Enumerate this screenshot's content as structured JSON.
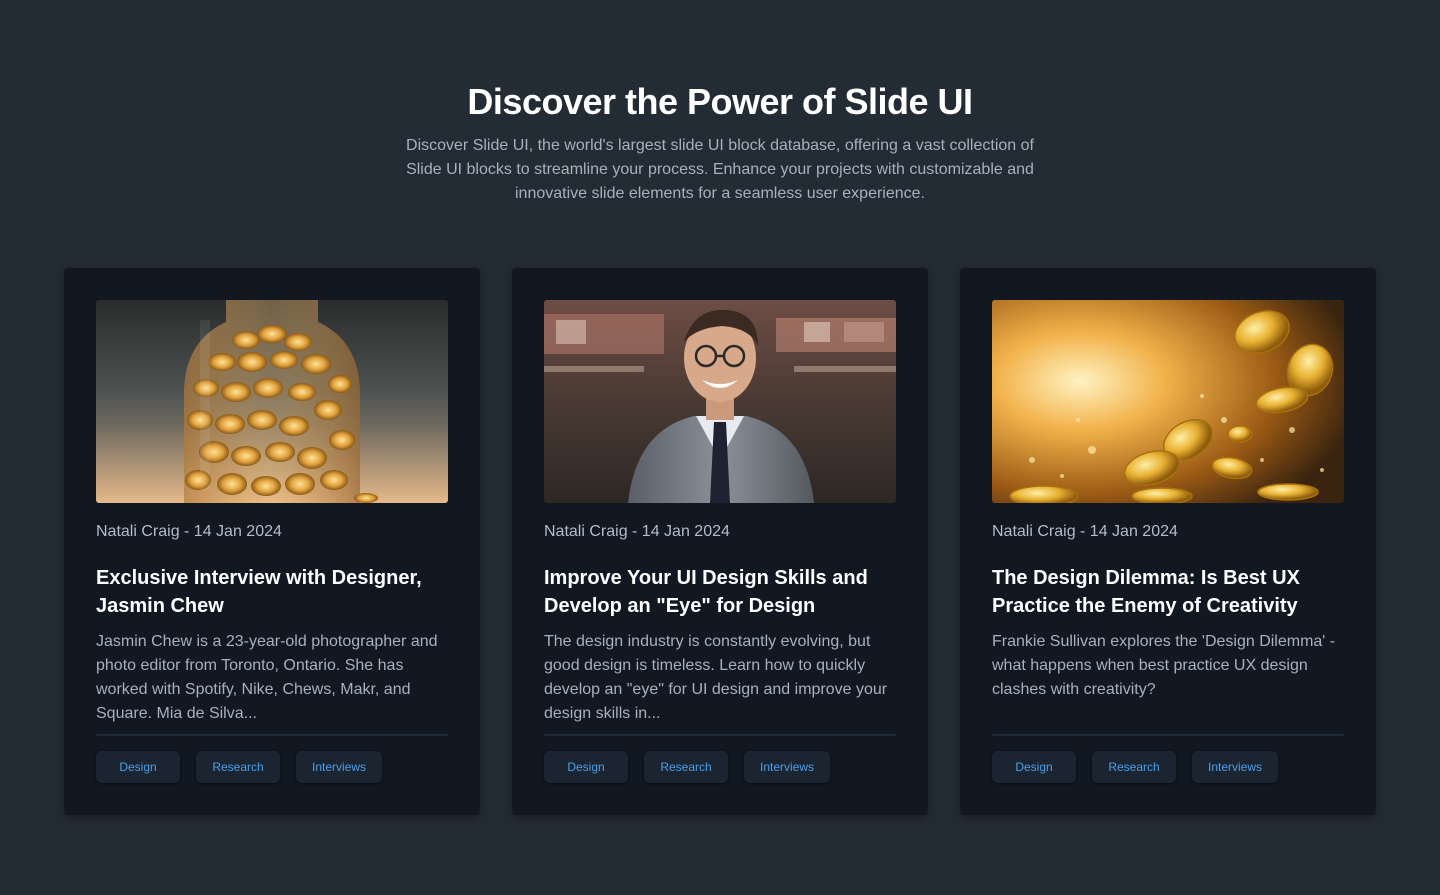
{
  "hero": {
    "title": "Discover the Power of Slide UI",
    "description": "Discover Slide UI, the world's largest slide UI block database, offering a vast collection of Slide UI blocks to streamline your process. Enhance your projects with customizable and innovative slide elements for a seamless user experience."
  },
  "cards": [
    {
      "image": "coin-jar-image",
      "meta": "Natali Craig - 14 Jan 2024",
      "title": "Exclusive Interview with Designer, Jasmin Chew",
      "description": "Jasmin Chew is a 23-year-old photographer and photo editor from Toronto, Ontario. She has worked with Spotify, Nike, Chews, Makr, and Square. Mia de Silva...",
      "tags": [
        "Design",
        "Research",
        "Interviews"
      ]
    },
    {
      "image": "smiling-man-portrait-image",
      "meta": "Natali Craig - 14 Jan 2024",
      "title": "Improve Your UI Design Skills and Develop an \"Eye\" for Design",
      "description": "The design industry is constantly evolving, but good design is timeless. Learn how to quickly develop an \"eye\" for UI design and improve your design skills in...",
      "tags": [
        "Design",
        "Research",
        "Interviews"
      ]
    },
    {
      "image": "falling-gold-coins-image",
      "meta": "Natali Craig - 14 Jan 2024",
      "title": "The Design Dilemma: Is Best UX Practice the Enemy of Creativity",
      "description": "Frankie Sullivan explores the 'Design Dilemma' - what happens when best practice UX design clashes with creativity?",
      "tags": [
        "Design",
        "Research",
        "Interviews"
      ]
    }
  ],
  "colors": {
    "background": "#232b34",
    "card": "#111822",
    "tag_text": "#4a9eea",
    "tag_bg": "#1b2532"
  }
}
